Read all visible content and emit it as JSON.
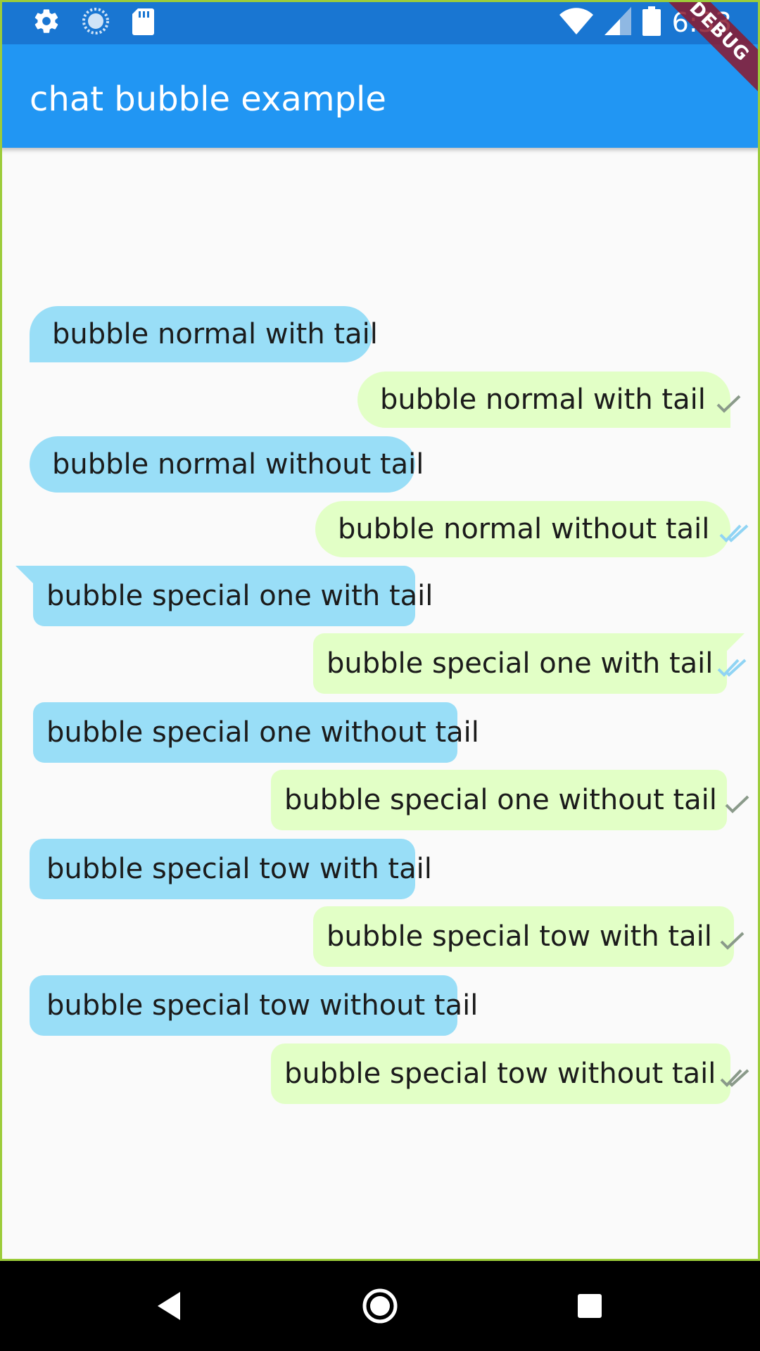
{
  "status_bar": {
    "time": "6:33",
    "left_icons": [
      "gear-icon",
      "sync-icon",
      "sd-card-icon"
    ],
    "right_icons": [
      "wifi-icon",
      "signal-icon",
      "battery-icon"
    ]
  },
  "app_bar": {
    "title": "chat bubble example"
  },
  "debug_banner": "DEBUG",
  "colors": {
    "received": "#99def7",
    "sent": "#e2ffc6",
    "app_bar": "#2196f3",
    "status_bar": "#1976d2"
  },
  "messages": [
    {
      "text": "bubble normal with tail",
      "sender": "other",
      "style": "normal",
      "tail": true,
      "status": "none"
    },
    {
      "text": "bubble normal with tail",
      "sender": "me",
      "style": "normal",
      "tail": true,
      "status": "sent"
    },
    {
      "text": "bubble normal without tail",
      "sender": "other",
      "style": "normal",
      "tail": false,
      "status": "none"
    },
    {
      "text": "bubble normal without tail",
      "sender": "me",
      "style": "normal",
      "tail": false,
      "status": "seen"
    },
    {
      "text": "bubble special one with tail",
      "sender": "other",
      "style": "special-one",
      "tail": true,
      "status": "none"
    },
    {
      "text": "bubble special one with tail",
      "sender": "me",
      "style": "special-one",
      "tail": true,
      "status": "seen"
    },
    {
      "text": "bubble special one without tail",
      "sender": "other",
      "style": "special-one",
      "tail": false,
      "status": "none"
    },
    {
      "text": "bubble special one without tail",
      "sender": "me",
      "style": "special-one",
      "tail": false,
      "status": "sent"
    },
    {
      "text": "bubble special tow with tail",
      "sender": "other",
      "style": "special-tow",
      "tail": true,
      "status": "none"
    },
    {
      "text": "bubble special tow with tail",
      "sender": "me",
      "style": "special-tow",
      "tail": true,
      "status": "sent"
    },
    {
      "text": "bubble special tow without tail",
      "sender": "other",
      "style": "special-tow",
      "tail": false,
      "status": "none"
    },
    {
      "text": "bubble special tow without tail",
      "sender": "me",
      "style": "special-tow",
      "tail": false,
      "status": "delivered"
    }
  ],
  "nav_bar": {
    "buttons": [
      "back-icon",
      "home-icon",
      "recents-icon"
    ]
  }
}
